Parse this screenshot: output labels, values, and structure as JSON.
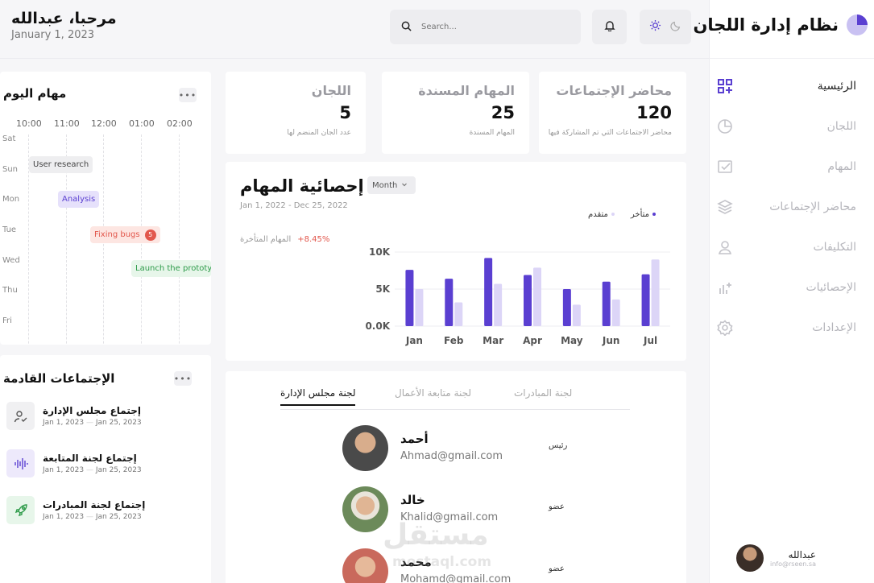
{
  "sidebar": {
    "title": "نظام إدارة اللجان",
    "items": [
      {
        "label": "الرئيسية",
        "icon": "dashboard-icon",
        "active": true
      },
      {
        "label": "اللجان",
        "icon": "pie-chart-icon",
        "active": false
      },
      {
        "label": "المهام",
        "icon": "checkbox-icon",
        "active": false
      },
      {
        "label": "محاضر الإجتماعات",
        "icon": "layers-icon",
        "active": false
      },
      {
        "label": "التكليفات",
        "icon": "user-icon",
        "active": false
      },
      {
        "label": "الإحصائيات",
        "icon": "stats-icon",
        "active": false
      },
      {
        "label": "الإعدادات",
        "icon": "settings-icon",
        "active": false
      }
    ],
    "profile": {
      "name": "عبدالله",
      "email": "info@rseen.sa"
    }
  },
  "header": {
    "greeting": "مرحبا، عبدالله",
    "date": "January 1, 2023",
    "search_placeholder": "Search..."
  },
  "stats": [
    {
      "title": "محاضر الإجتماعات",
      "value": "120",
      "sub": "محاضر الاجتماعات التي تم المشاركة فيها"
    },
    {
      "title": "المهام المسندة",
      "value": "25",
      "sub": "المهام المسندة"
    },
    {
      "title": "اللجان",
      "value": "5",
      "sub": "عدد الجان المنضم لها"
    }
  ],
  "schedule": {
    "title": "مهام اليوم",
    "times": [
      "10:00",
      "11:00",
      "12:00",
      "01:00",
      "02:00"
    ],
    "days": [
      "Sat",
      "Sun",
      "Mon",
      "Tue",
      "Wed",
      "Thu",
      "Fri"
    ],
    "events": [
      {
        "label": "User research",
        "day": "Sun"
      },
      {
        "label": "Analysis",
        "day": "Mon"
      },
      {
        "label": "Fixing bugs",
        "day": "Tue",
        "badge": "5"
      },
      {
        "label": "Launch the prototype",
        "day": "Wed"
      }
    ]
  },
  "chart_card": {
    "title": "إحصائية المهام",
    "range": "Jan 1, 2022 - Dec 25, 2022",
    "period": "Month",
    "late_label": "المهام المتأخرة",
    "late_change": "+8.45%"
  },
  "chart_data": {
    "type": "bar",
    "categories": [
      "Jan",
      "Feb",
      "Mar",
      "Apr",
      "May",
      "Jun",
      "Jul"
    ],
    "series": [
      {
        "name": "متأخر",
        "color": "#5a3fd1",
        "values": [
          7.6,
          6.4,
          9.2,
          6.9,
          5.0,
          6.0,
          7.0
        ]
      },
      {
        "name": "متقدم",
        "color": "#dcd5f7",
        "values": [
          5.0,
          3.2,
          5.7,
          7.9,
          2.9,
          3.6,
          9.0
        ]
      }
    ],
    "ylim": [
      0,
      10
    ],
    "yticks": [
      "0.0K",
      "5K",
      "10K"
    ],
    "grid": true,
    "legend": "top-right"
  },
  "meetings": {
    "title": "الإجتماعات القادمة",
    "items": [
      {
        "name": "إجتماع مجلس الإدارة",
        "from": "Jan 1, 2023",
        "to": "Jan 25, 2023",
        "icon": "user-check-icon",
        "bg": "#f0f0f2",
        "fg": "#555"
      },
      {
        "name": "إجتماع لجنة المتابعة",
        "from": "Jan 1, 2023",
        "to": "Jan 25, 2023",
        "icon": "waveform-icon",
        "bg": "#ede9fb",
        "fg": "#5a3fd1"
      },
      {
        "name": "إجتماع لجنة المبادرات",
        "from": "Jan 1, 2023",
        "to": "Jan 25, 2023",
        "icon": "rocket-icon",
        "bg": "#e7f6ea",
        "fg": "#2e9b4a"
      }
    ],
    "date_sep": "—"
  },
  "members": {
    "tabs": [
      "لجنة مجلس الإدارة",
      "لجنة متابعة الأعمال",
      "لجنة المبادرات"
    ],
    "list": [
      {
        "name": "أحمد",
        "email": "Ahmad@gmail.com",
        "role": "رئيس"
      },
      {
        "name": "خالد",
        "email": "Khalid@gmail.com",
        "role": "عضو"
      },
      {
        "name": "محمد",
        "email": "Mohamd@gmail.com",
        "role": "عضو"
      }
    ]
  },
  "watermark": {
    "text": "مستقل",
    "sub": "mostaql.com"
  }
}
